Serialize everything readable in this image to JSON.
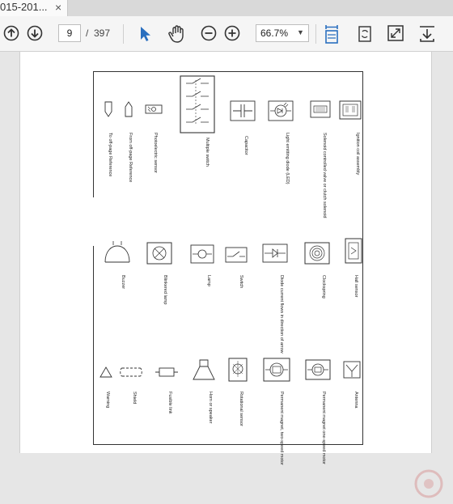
{
  "tab": {
    "title": "015-201...",
    "close": "×"
  },
  "toolbar": {
    "current_page": "9",
    "page_separator": "/",
    "total_pages": "397",
    "zoom": "66.7%"
  },
  "icons": [
    "page-up-icon",
    "page-down-icon",
    "select-tool-icon",
    "hand-tool-icon",
    "zoom-out-icon",
    "zoom-in-icon",
    "zoom-caret-icon",
    "fit-width-icon",
    "rotate-icon",
    "fullscreen-icon",
    "download-icon"
  ],
  "symbols": [
    {
      "caption": "To off-page Reference"
    },
    {
      "caption": "From off-page Reference"
    },
    {
      "caption": "Photoelectric sensor"
    },
    {
      "caption": "Multiple switch"
    },
    {
      "caption": "Capacitor"
    },
    {
      "caption": "Light emitting diode (LED)"
    },
    {
      "caption": "Solenoid controlled valve or clutch solenoid"
    },
    {
      "caption": "Ignition coil assembly"
    },
    {
      "caption": "Buzzer"
    },
    {
      "caption": "Blinkered lamp"
    },
    {
      "caption": "Lamp"
    },
    {
      "caption": "Switch"
    },
    {
      "caption": "Diode current flows in direction of arrow"
    },
    {
      "caption": "Clockspring"
    },
    {
      "caption": "Hall sensor"
    },
    {
      "caption": "Warning"
    },
    {
      "caption": "Shield"
    },
    {
      "caption": "Fusible link"
    },
    {
      "caption": "Horn or speaker"
    },
    {
      "caption": "Rotational sensor"
    },
    {
      "caption": "Permanent magnet, two-speed motor"
    },
    {
      "caption": "Permanent magnet one-speed motor"
    },
    {
      "caption": "Antenna"
    }
  ]
}
